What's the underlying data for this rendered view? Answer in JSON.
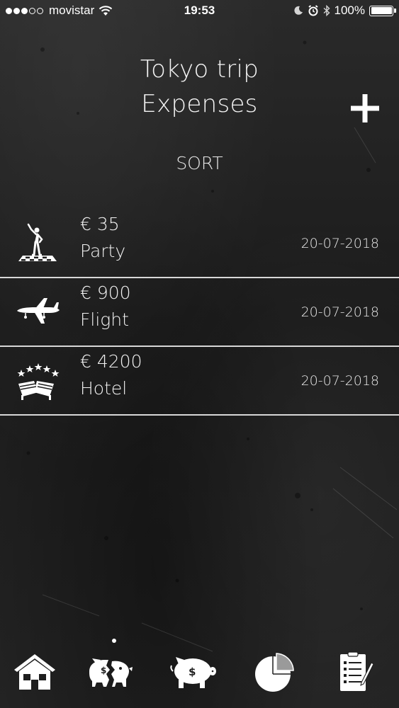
{
  "status_bar": {
    "carrier": "movistar",
    "time": "19:53",
    "battery": "100%",
    "icons": [
      "signal-dots-icon",
      "wifi-icon",
      "moon-icon",
      "alarm-icon",
      "bluetooth-icon",
      "battery-icon"
    ]
  },
  "header": {
    "title_line1": "Tokyo trip",
    "title_line2": "Expenses",
    "add_icon": "plus-icon"
  },
  "sort": {
    "label": "SORT"
  },
  "expenses": [
    {
      "amount": "€ 35",
      "category": "Party",
      "date": "20-07-2018",
      "icon": "party-dancer-icon"
    },
    {
      "amount": "€ 900",
      "category": "Flight",
      "date": "20-07-2018",
      "icon": "airplane-icon"
    },
    {
      "amount": "€ 4200",
      "category": "Hotel",
      "date": "20-07-2018",
      "icon": "hotel-stars-icon"
    }
  ],
  "tab_bar": {
    "tabs": [
      {
        "icon": "home-icon"
      },
      {
        "icon": "broken-piggy-bank-icon"
      },
      {
        "icon": "piggy-bank-icon"
      },
      {
        "icon": "pie-chart-icon"
      },
      {
        "icon": "report-clipboard-icon"
      }
    ]
  },
  "colors": {
    "background": "#1e1e1e",
    "text": "#f2f2f2",
    "divider": "#d8d8d8"
  }
}
